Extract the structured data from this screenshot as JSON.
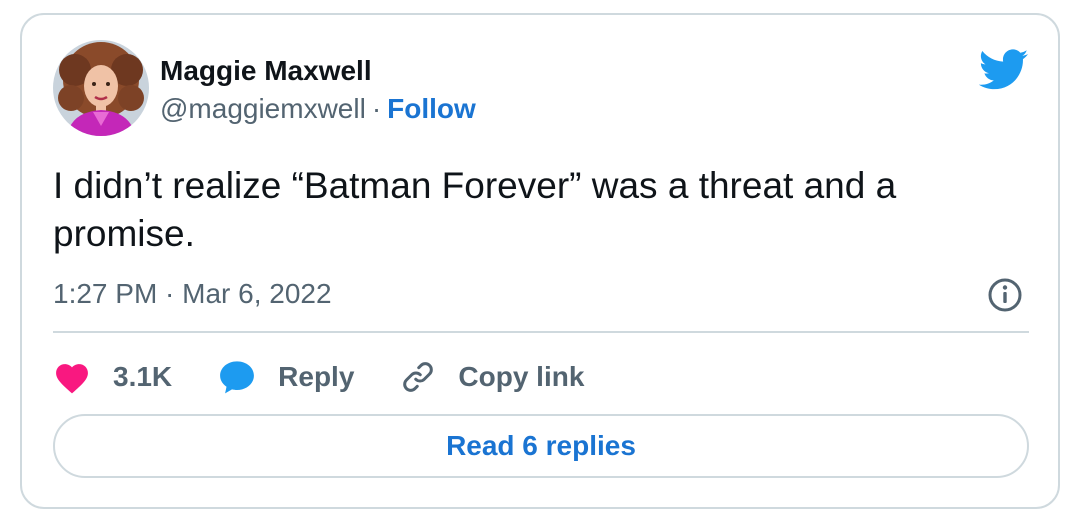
{
  "author": {
    "name": "Maggie Maxwell",
    "handle": "@maggiemxwell",
    "separator": "·",
    "follow_label": "Follow"
  },
  "tweet": {
    "text": "I didn’t realize “Batman Forever” was a threat and a promise.",
    "timestamp": "1:27 PM · Mar 6, 2022"
  },
  "actions": {
    "like_count": "3.1K",
    "reply_label": "Reply",
    "copy_link_label": "Copy link"
  },
  "read_replies_label": "Read 6 replies",
  "icons": {
    "brand": "twitter-bird-icon",
    "info": "info-icon",
    "like": "heart-icon",
    "reply": "speech-bubble-icon",
    "copy": "link-icon"
  },
  "colors": {
    "accent": "#1a74d2",
    "bird": "#1d9bf0",
    "heart": "#f91880",
    "text": "#0f1419",
    "muted": "#536471",
    "border": "#cfd9de"
  }
}
